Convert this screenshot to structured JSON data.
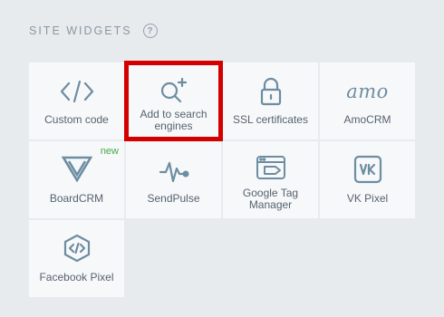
{
  "header": {
    "title": "SITE WIDGETS",
    "help_glyph": "?"
  },
  "widgets": [
    {
      "label": "Custom code",
      "icon": "code-icon"
    },
    {
      "label": "Add to search engines",
      "icon": "search-plus-icon",
      "selected": true
    },
    {
      "label": "SSL certificates",
      "icon": "lock-icon"
    },
    {
      "label": "AmoCRM",
      "icon": "amocrm-logo",
      "logo_text": "amo"
    },
    {
      "label": "BoardCRM",
      "icon": "boardcrm-logo",
      "badge": "new"
    },
    {
      "label": "SendPulse",
      "icon": "pulse-icon"
    },
    {
      "label": "Google Tag Manager",
      "icon": "tag-manager-icon"
    },
    {
      "label": "VK Pixel",
      "icon": "vk-icon"
    },
    {
      "label": "Facebook Pixel",
      "icon": "code-hexagon-icon"
    }
  ],
  "colors": {
    "background": "#e8ebee",
    "tile": "#f7f8fa",
    "icon": "#6d8da1",
    "label": "#56636e",
    "highlight": "#d40000",
    "new_badge": "#47a94a"
  }
}
